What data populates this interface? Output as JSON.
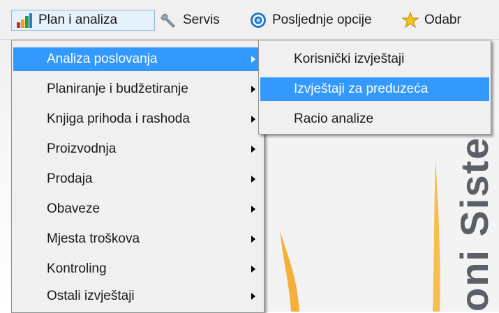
{
  "menubar": {
    "items": [
      {
        "label": "Plan i analiza",
        "icon": "bar-chart-icon"
      },
      {
        "label": "Servis",
        "icon": "wrench-icon"
      },
      {
        "label": "Posljednje opcije",
        "icon": "target-icon"
      },
      {
        "label": "Odabr",
        "icon": "star-icon"
      }
    ]
  },
  "main_menu": {
    "items": [
      {
        "label": "Analiza poslovanja"
      },
      {
        "label": "Planiranje i budžetiranje"
      },
      {
        "label": "Knjiga prihoda i rashoda"
      },
      {
        "label": "Proizvodnja"
      },
      {
        "label": "Prodaja"
      },
      {
        "label": "Obaveze"
      },
      {
        "label": "Mjesta troškova"
      },
      {
        "label": "Kontroling"
      },
      {
        "label": "Ostali izvještaji"
      }
    ]
  },
  "submenu": {
    "items": [
      {
        "label": "Korisnički izvještaji"
      },
      {
        "label": "Izvještaji za preduzeća"
      },
      {
        "label": "Racio analize"
      }
    ]
  },
  "background": {
    "vertical_text": "oni Sistem"
  },
  "colors": {
    "highlight": "#3399ff",
    "menu_bg": "#f0f0f0"
  }
}
